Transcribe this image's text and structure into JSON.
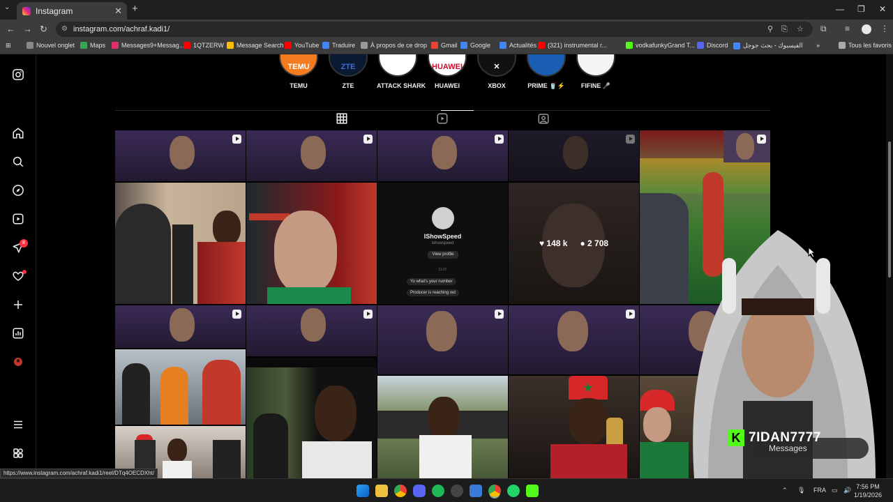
{
  "browser": {
    "tab_title": "Instagram",
    "url": "instagram.com/achraf.kadi1/",
    "status_url": "https://www.instagram.com/achraf.kadi1/reel/DTq4OECDXht/",
    "bookmarks": [
      {
        "label": "Nouvel onglet",
        "color": "#888888"
      },
      {
        "label": "Maps",
        "color": "#34a853"
      },
      {
        "label": "Messages9+Messag...",
        "color": "#e1306c"
      },
      {
        "label": "1QTZERW",
        "color": "#ff0000"
      },
      {
        "label": "Message Search",
        "color": "#fbbc04"
      },
      {
        "label": "YouTube",
        "color": "#ff0000"
      },
      {
        "label": "Traduire",
        "color": "#4285f4"
      },
      {
        "label": "À propos de ce drop",
        "color": "#999999"
      },
      {
        "label": "Gmail",
        "color": "#ea4335"
      },
      {
        "label": "Google",
        "color": "#4285f4"
      },
      {
        "label": "Actualités",
        "color": "#4285f4"
      },
      {
        "label": "(321) instrumental r...",
        "color": "#ff0000"
      },
      {
        "label": "vodkafunkyGrand T...",
        "color": "#53fc18"
      },
      {
        "label": "Discord",
        "color": "#5865f2"
      },
      {
        "label": "الفيسبوك - بحث جوجل",
        "color": "#4285f4"
      }
    ],
    "all_bookmarks": "Tous les favoris"
  },
  "highlights": [
    {
      "label": "TEMU",
      "inner": "TEMU",
      "bg": "#f47b20",
      "fg": "#ffffff"
    },
    {
      "label": "ZTE",
      "inner": "ZTE",
      "bg": "#0a1a33",
      "fg": "#3a6fd8"
    },
    {
      "label": "ATTACK SHARK",
      "inner": "",
      "bg": "#ffffff",
      "fg": "#000000"
    },
    {
      "label": "HUAWEI",
      "inner": "HUAWEI",
      "bg": "#ffffff",
      "fg": "#cf0a2c"
    },
    {
      "label": "XBOX",
      "inner": "✕",
      "bg": "#111111",
      "fg": "#ffffff"
    },
    {
      "label": "PRIME 🥤⚡",
      "inner": "",
      "bg": "#1a5fb4",
      "fg": "#ffffff"
    },
    {
      "label": "FIFINE 🎤",
      "inner": "",
      "bg": "#f5f5f5",
      "fg": "#222222"
    }
  ],
  "post_stats": {
    "likes": "148 k",
    "comments": "2 708"
  },
  "dm_card": {
    "name": "IShowSpeed",
    "handle": "ishowspeed",
    "button": "View profile",
    "time": "11:07",
    "msg1": "Yo what's your number",
    "msg2": "Producer is reaching out"
  },
  "overlay": {
    "streamer": "7IDAN7777",
    "messages_label": "Messages"
  },
  "taskbar": {
    "lang": "FRA",
    "time": "7:56 PM",
    "date": "1/19/2026"
  },
  "colors": {
    "accent_live": "#53fc18",
    "badge": "#ff3040",
    "bg": "#000000"
  }
}
